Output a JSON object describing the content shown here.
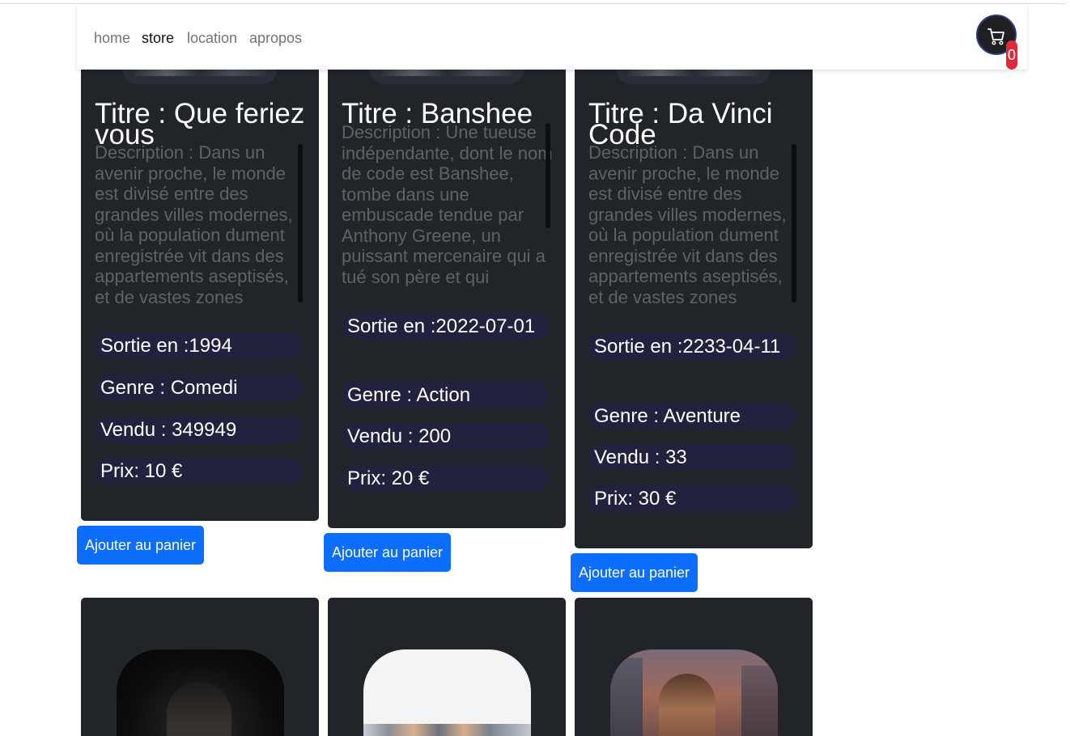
{
  "nav": {
    "links": [
      "home",
      "store",
      "location",
      "apropos"
    ],
    "active": "store",
    "cart_count": "0"
  },
  "movies": [
    {
      "title": "Titre : Que feriez vous",
      "description": "Description : Dans un avenir proche, le monde est divisé entre des grandes villes modernes, où la population dument enregistrée vit dans des appartements aseptisés, et de vastes zones",
      "release": "Sortie en :1994",
      "genre": "Genre : Comedi",
      "sold": "Vendu : 349949",
      "price": "Prix: 10 €",
      "button": "Ajouter au panier"
    },
    {
      "title": "Titre : Banshee",
      "description": "Description : Une tueuse indépendante, dont le nom de code est Banshee, tombe dans une embuscade tendue par Anthony Greene, un puissant mercenaire qui a tué son père et qui cherche",
      "release": "Sortie en :2022-07-01",
      "genre": "Genre : Action",
      "sold": "Vendu : 200",
      "price": "Prix: 20 €",
      "button": "Ajouter au panier"
    },
    {
      "title": "Titre : Da Vinci Code",
      "description": "Description : Dans un avenir proche, le monde est divisé entre des grandes villes modernes, où la population dument enregistrée vit dans des appartements aseptisés, et de vastes zones",
      "release": "Sortie en :2233-04-11",
      "genre": "Genre : Aventure",
      "sold": "Vendu : 33",
      "price": "Prix: 30 €",
      "button": "Ajouter au panier"
    }
  ],
  "colors": {
    "card_bg": "#212428",
    "pill_bg": "#22223f",
    "button_bg": "#0d6efd",
    "badge_bg": "#e02a3c"
  }
}
